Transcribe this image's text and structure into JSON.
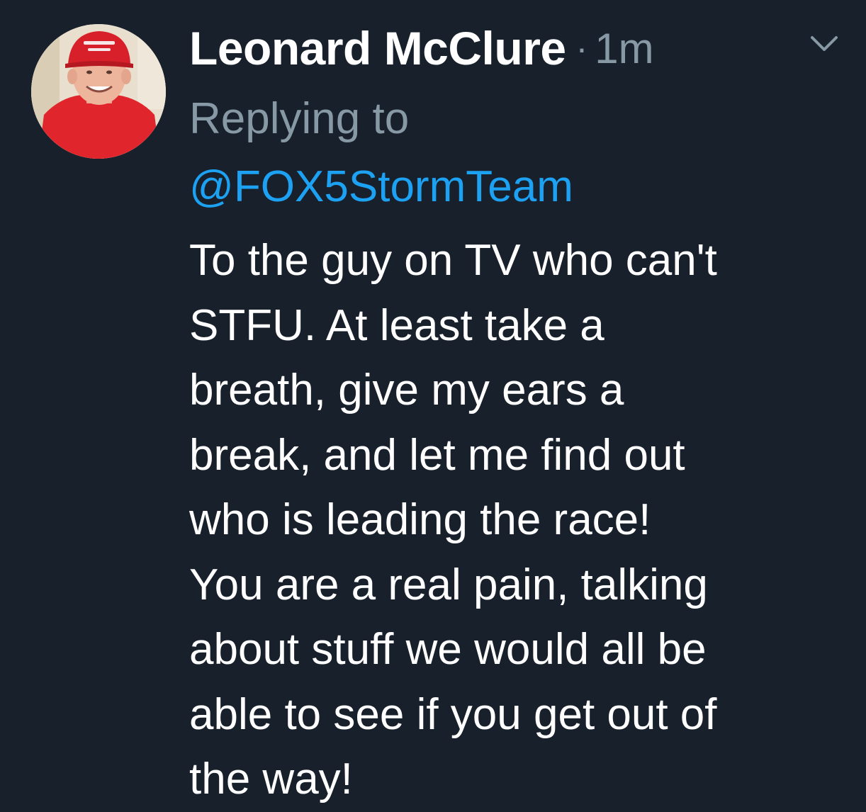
{
  "tweet": {
    "author": {
      "display_name": "Leonard McClure",
      "avatar_icon": "profile-photo"
    },
    "separator": "·",
    "timestamp": "1m",
    "replying_label": "Replying to",
    "reply_to_handle": "@FOX5StormTeam",
    "body_lines": [
      "To the guy on TV who can't",
      "STFU. At least take a",
      "breath, give my ears a",
      "break, and let me find out",
      "who is leading the race!",
      "You are a real pain, talking",
      "about stuff we would all be",
      "able to see if you get out of",
      "the way!"
    ],
    "menu_icon": "chevron-down-icon"
  },
  "colors": {
    "background": "#18202b",
    "primary_text": "#ffffff",
    "secondary_text": "#8899a6",
    "link": "#1da1f2"
  }
}
